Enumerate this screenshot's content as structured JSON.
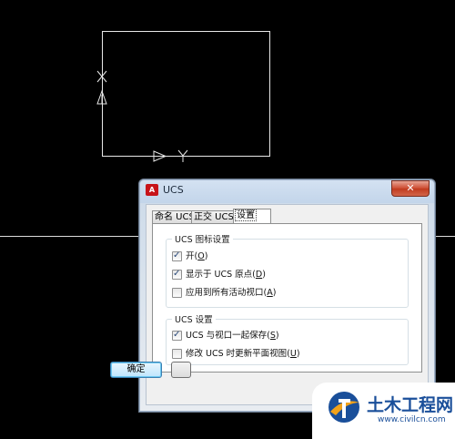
{
  "viewport": {
    "ucs_icon": {
      "x_label": "X",
      "y_label": "Y"
    }
  },
  "dialog": {
    "title": "UCS",
    "app_logo_text": "A",
    "close_glyph": "✕",
    "tabs": [
      {
        "label": "命名 UCS",
        "active": false
      },
      {
        "label": "正交 UCS",
        "active": false
      },
      {
        "label": "设置",
        "active": true
      }
    ],
    "groups": {
      "icon_settings": {
        "title": "UCS 图标设置",
        "options": [
          {
            "text": "开",
            "key": "O",
            "checked": true
          },
          {
            "text": "显示于 UCS 原点",
            "key": "D",
            "checked": true
          },
          {
            "text": "应用到所有活动视口",
            "key": "A",
            "checked": false
          }
        ]
      },
      "ucs_settings": {
        "title": "UCS 设置",
        "options": [
          {
            "text": "UCS 与视口一起保存",
            "key": "S",
            "checked": true
          },
          {
            "text": "修改 UCS 时更新平面视图",
            "key": "U",
            "checked": false
          }
        ]
      }
    },
    "buttons": {
      "ok": "确定",
      "cancel": ""
    }
  },
  "watermark": {
    "title": "土木工程网",
    "url": "www.civilcn.com",
    "accent": "#1a4f9a"
  }
}
